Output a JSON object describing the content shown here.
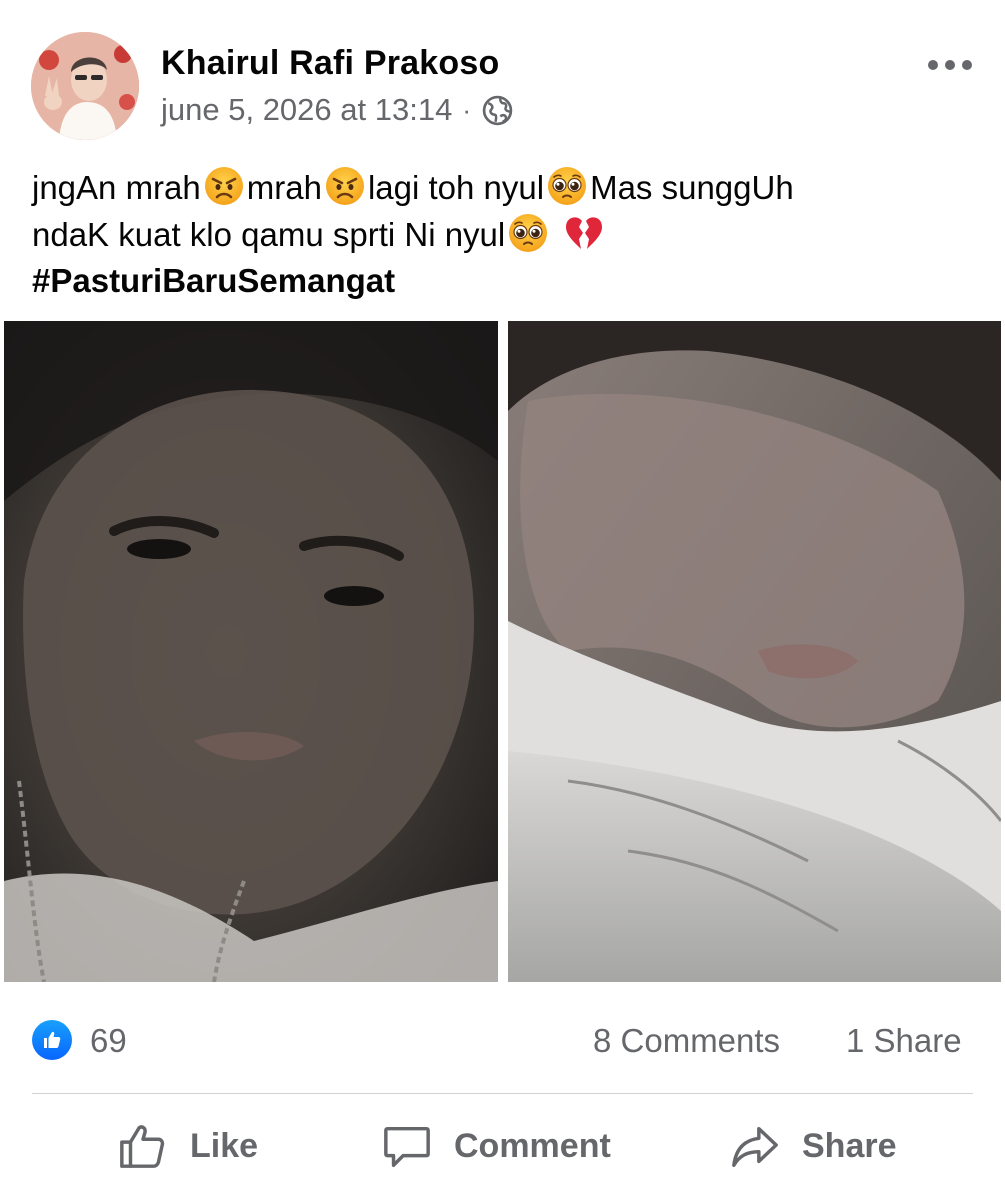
{
  "post": {
    "author": "Khairul Rafi Prakoso",
    "timestamp": "june 5, 2026 at 13:14",
    "separator": "·",
    "audience_icon": "globe-icon",
    "caption": {
      "segments": [
        {
          "text": "jngAn mrah"
        },
        {
          "emoji": "angry-face"
        },
        {
          "text": "mrah"
        },
        {
          "emoji": "angry-face"
        },
        {
          "text": "lagi toh nyul"
        },
        {
          "emoji": "pleading-face"
        },
        {
          "text": "Mas sunggUh"
        },
        {
          "text": "ndaK kuat klo qamu sprti Ni nyul"
        },
        {
          "emoji": "pleading-face"
        },
        {
          "emoji": "broken-heart"
        }
      ],
      "line1_a": "jngAn mrah",
      "line1_b": "mrah",
      "line1_c": "lagi toh nyul",
      "line1_d": "Mas sunggUh",
      "line2_a": "ndaK kuat klo qamu sprti Ni nyul",
      "hashtag": "#PasturiBaruSemangat"
    },
    "photos": [
      {
        "name": "photo-1"
      },
      {
        "name": "photo-2"
      }
    ]
  },
  "stats": {
    "like_count": "69",
    "comments": "8 Comments",
    "shares": "1 Share"
  },
  "actions": {
    "like": "Like",
    "comment": "Comment",
    "share": "Share"
  },
  "colors": {
    "text_primary": "#050505",
    "text_secondary": "#65676b",
    "like_blue": "#0866ff",
    "divider": "#d0d2d6"
  }
}
